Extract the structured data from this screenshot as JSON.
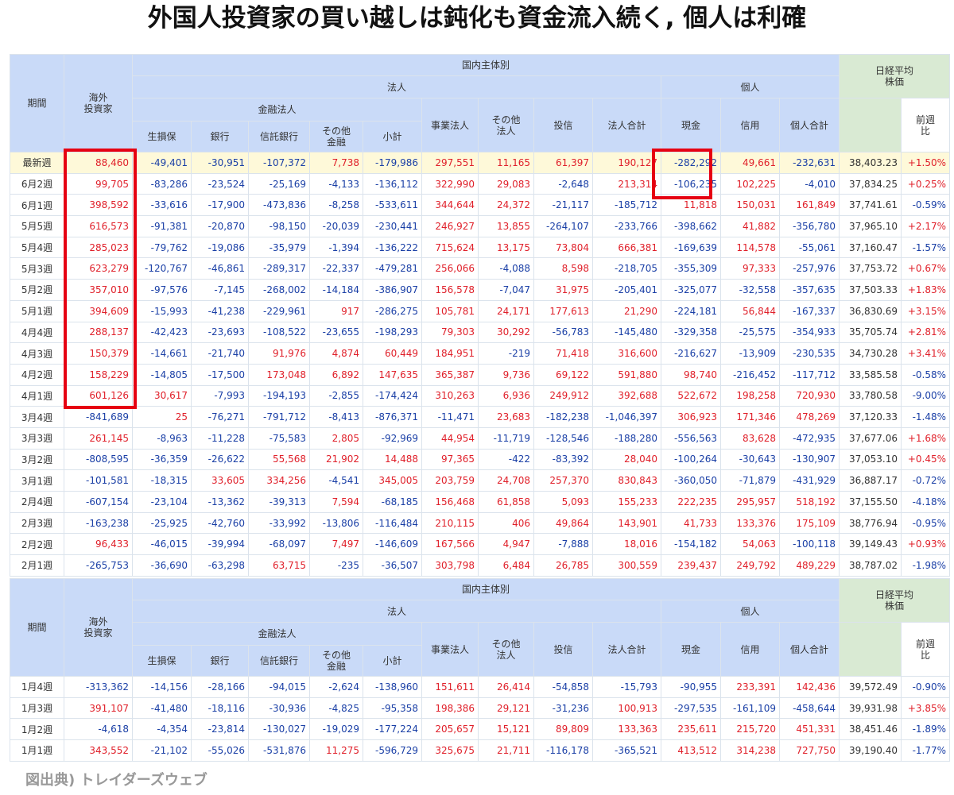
{
  "title": "外国人投資家の買い越しは鈍化も資金流入続く, 個人は利確",
  "source": "図出典) トレイダーズウェブ",
  "colors": {
    "positive": "#e0202a",
    "negative": "#1a3fa6",
    "header": "#c9daf8",
    "nikkei_header": "#d9ead3",
    "highlight_row": "#fef9d9",
    "box": "#e60012"
  },
  "headers": {
    "period": "期間",
    "foreign": "海外\n投資家",
    "domestic": "国内主体別",
    "corporate": "法人",
    "individual": "個人",
    "financial": "金融法人",
    "nikkei": "日経平均\n株価",
    "wow": "前週\n比",
    "cols": [
      "生損保",
      "銀行",
      "信託銀行",
      "その他\n金融",
      "小計",
      "事業法人",
      "その他\n法人",
      "投信",
      "法人合計",
      "現金",
      "信用",
      "個人合計"
    ]
  },
  "rows1": [
    [
      "最新週",
      "88,460",
      "-49,401",
      "-30,951",
      "-107,372",
      "7,738",
      "-179,986",
      "297,551",
      "11,165",
      "61,397",
      "190,127",
      "-282,292",
      "49,661",
      "-232,631",
      "38,403.23",
      "+1.50%"
    ],
    [
      "6月2週",
      "99,705",
      "-83,286",
      "-23,524",
      "-25,169",
      "-4,133",
      "-136,112",
      "322,990",
      "29,083",
      "-2,648",
      "213,314",
      "-106,235",
      "102,225",
      "-4,010",
      "37,834.25",
      "+0.25%"
    ],
    [
      "6月1週",
      "398,592",
      "-33,616",
      "-17,900",
      "-473,836",
      "-8,258",
      "-533,611",
      "344,644",
      "24,372",
      "-21,117",
      "-185,712",
      "11,818",
      "150,031",
      "161,849",
      "37,741.61",
      "-0.59%"
    ],
    [
      "5月5週",
      "616,573",
      "-91,381",
      "-20,870",
      "-98,150",
      "-20,039",
      "-230,441",
      "246,927",
      "13,855",
      "-264,107",
      "-233,766",
      "-398,662",
      "41,882",
      "-356,780",
      "37,965.10",
      "+2.17%"
    ],
    [
      "5月4週",
      "285,023",
      "-79,762",
      "-19,086",
      "-35,979",
      "-1,394",
      "-136,222",
      "715,624",
      "13,175",
      "73,804",
      "666,381",
      "-169,639",
      "114,578",
      "-55,061",
      "37,160.47",
      "-1.57%"
    ],
    [
      "5月3週",
      "623,279",
      "-120,767",
      "-46,861",
      "-289,317",
      "-22,337",
      "-479,281",
      "256,066",
      "-4,088",
      "8,598",
      "-218,705",
      "-355,309",
      "97,333",
      "-257,976",
      "37,753.72",
      "+0.67%"
    ],
    [
      "5月2週",
      "357,010",
      "-97,576",
      "-7,145",
      "-268,002",
      "-14,184",
      "-386,907",
      "156,578",
      "-7,047",
      "31,975",
      "-205,401",
      "-325,077",
      "-32,558",
      "-357,635",
      "37,503.33",
      "+1.83%"
    ],
    [
      "5月1週",
      "394,609",
      "-15,993",
      "-41,238",
      "-229,961",
      "917",
      "-286,275",
      "105,781",
      "24,171",
      "177,613",
      "21,290",
      "-224,181",
      "56,844",
      "-167,337",
      "36,830.69",
      "+3.15%"
    ],
    [
      "4月4週",
      "288,137",
      "-42,423",
      "-23,693",
      "-108,522",
      "-23,655",
      "-198,293",
      "79,303",
      "30,292",
      "-56,783",
      "-145,480",
      "-329,358",
      "-25,575",
      "-354,933",
      "35,705.74",
      "+2.81%"
    ],
    [
      "4月3週",
      "150,379",
      "-14,661",
      "-21,740",
      "91,976",
      "4,874",
      "60,449",
      "184,951",
      "-219",
      "71,418",
      "316,600",
      "-216,627",
      "-13,909",
      "-230,535",
      "34,730.28",
      "+3.41%"
    ],
    [
      "4月2週",
      "158,229",
      "-14,805",
      "-17,500",
      "173,048",
      "6,892",
      "147,635",
      "365,387",
      "9,736",
      "69,122",
      "591,880",
      "98,740",
      "-216,452",
      "-117,712",
      "33,585.58",
      "-0.58%"
    ],
    [
      "4月1週",
      "601,126",
      "30,617",
      "-7,993",
      "-194,193",
      "-2,855",
      "-174,424",
      "310,263",
      "6,936",
      "249,912",
      "392,688",
      "522,672",
      "198,258",
      "720,930",
      "33,780.58",
      "-9.00%"
    ],
    [
      "3月4週",
      "-841,689",
      "25",
      "-76,271",
      "-791,712",
      "-8,413",
      "-876,371",
      "-11,471",
      "23,683",
      "-182,238",
      "-1,046,397",
      "306,923",
      "171,346",
      "478,269",
      "37,120.33",
      "-1.48%"
    ],
    [
      "3月3週",
      "261,145",
      "-8,963",
      "-11,228",
      "-75,583",
      "2,805",
      "-92,969",
      "44,954",
      "-11,719",
      "-128,546",
      "-188,280",
      "-556,563",
      "83,628",
      "-472,935",
      "37,677.06",
      "+1.68%"
    ],
    [
      "3月2週",
      "-808,595",
      "-36,359",
      "-26,622",
      "55,568",
      "21,902",
      "14,488",
      "97,365",
      "-422",
      "-83,392",
      "28,040",
      "-100,264",
      "-30,643",
      "-130,907",
      "37,053.10",
      "+0.45%"
    ],
    [
      "3月1週",
      "-101,581",
      "-18,315",
      "33,605",
      "334,256",
      "-4,541",
      "345,005",
      "203,759",
      "24,708",
      "257,370",
      "830,843",
      "-360,050",
      "-71,879",
      "-431,929",
      "36,887.17",
      "-0.72%"
    ],
    [
      "2月4週",
      "-607,154",
      "-23,104",
      "-13,362",
      "-39,313",
      "7,594",
      "-68,185",
      "156,468",
      "61,858",
      "5,093",
      "155,233",
      "222,235",
      "295,957",
      "518,192",
      "37,155.50",
      "-4.18%"
    ],
    [
      "2月3週",
      "-163,238",
      "-25,925",
      "-42,760",
      "-33,992",
      "-13,806",
      "-116,484",
      "210,115",
      "406",
      "49,864",
      "143,901",
      "41,733",
      "133,376",
      "175,109",
      "38,776.94",
      "-0.95%"
    ],
    [
      "2月2週",
      "96,433",
      "-46,015",
      "-39,994",
      "-68,097",
      "7,497",
      "-146,609",
      "167,566",
      "4,947",
      "-7,888",
      "18,016",
      "-154,182",
      "54,063",
      "-100,118",
      "39,149.43",
      "+0.93%"
    ],
    [
      "2月1週",
      "-265,753",
      "-36,690",
      "-63,298",
      "63,715",
      "-235",
      "-36,507",
      "303,798",
      "6,484",
      "26,785",
      "300,559",
      "239,437",
      "249,792",
      "489,229",
      "38,787.02",
      "-1.98%"
    ]
  ],
  "rows2": [
    [
      "1月4週",
      "-313,362",
      "-14,156",
      "-28,166",
      "-94,015",
      "-2,624",
      "-138,960",
      "151,611",
      "26,414",
      "-54,858",
      "-15,793",
      "-90,955",
      "233,391",
      "142,436",
      "39,572.49",
      "-0.90%"
    ],
    [
      "1月3週",
      "391,107",
      "-41,480",
      "-18,116",
      "-30,936",
      "-4,825",
      "-95,358",
      "198,386",
      "29,121",
      "-31,236",
      "100,913",
      "-297,535",
      "-161,109",
      "-458,644",
      "39,931.98",
      "+3.85%"
    ],
    [
      "1月2週",
      "-4,618",
      "-4,354",
      "-23,814",
      "-130,027",
      "-19,029",
      "-177,224",
      "205,657",
      "15,121",
      "89,809",
      "133,363",
      "235,611",
      "215,720",
      "451,331",
      "38,451.46",
      "-1.89%"
    ],
    [
      "1月1週",
      "343,552",
      "-21,102",
      "-55,026",
      "-531,876",
      "11,275",
      "-596,729",
      "325,675",
      "21,711",
      "-116,178",
      "-365,521",
      "413,512",
      "314,238",
      "727,750",
      "39,190.40",
      "-1.77%"
    ]
  ]
}
